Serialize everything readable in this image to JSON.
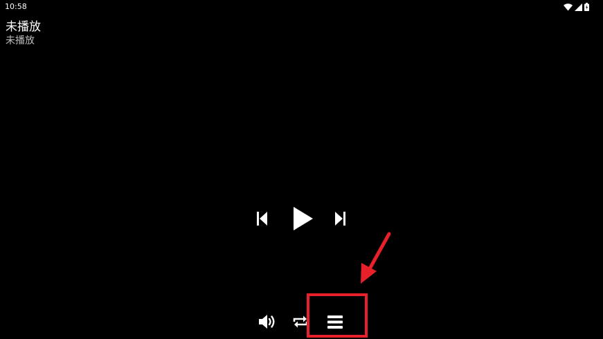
{
  "status_bar": {
    "time": "10:58",
    "icons": [
      "wifi-icon",
      "cell-signal-icon",
      "battery-icon"
    ]
  },
  "track": {
    "title": "未播放",
    "subtitle": "未播放"
  },
  "controls": {
    "transport": [
      "previous-icon",
      "play-icon",
      "next-icon"
    ],
    "bottom": [
      "volume-icon",
      "repeat-icon",
      "playlist-icon"
    ]
  },
  "annotation": {
    "color": "#e8202a",
    "target": "playlist-button"
  },
  "colors": {
    "background": "#000000",
    "foreground": "#ffffff",
    "secondary_text": "#bdbdbd"
  }
}
